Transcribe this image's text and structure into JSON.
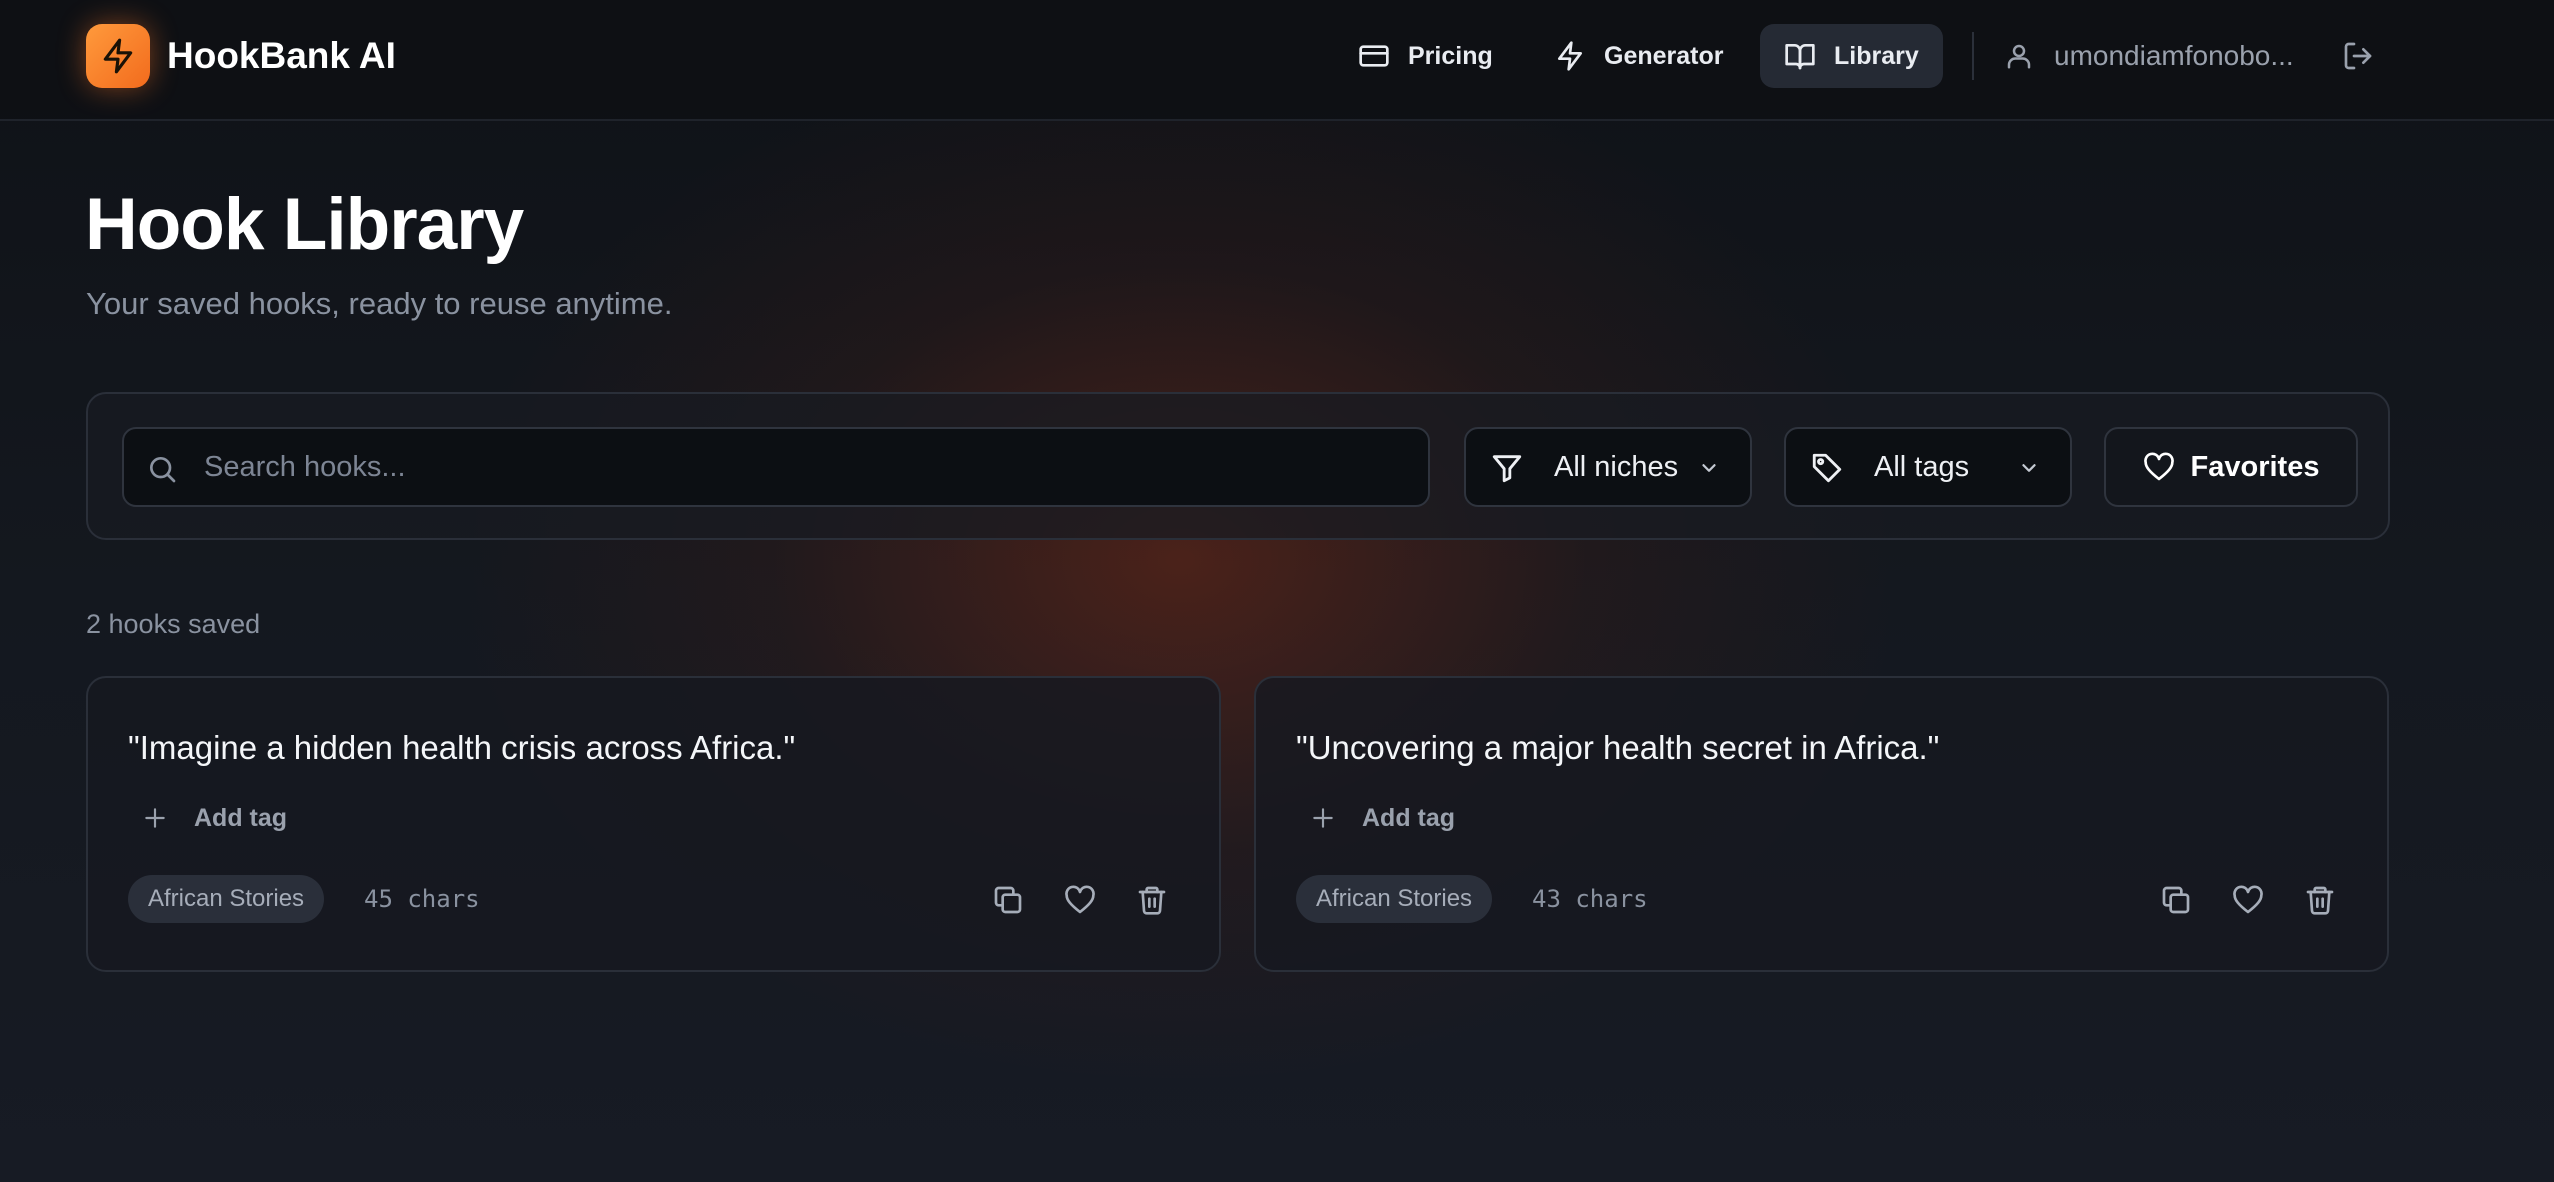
{
  "header": {
    "brand": "HookBank AI",
    "logo_icon": "lightning-icon",
    "nav": [
      {
        "label": "Pricing",
        "icon": "credit-card-icon",
        "active": false
      },
      {
        "label": "Generator",
        "icon": "lightning-icon",
        "active": false
      },
      {
        "label": "Library",
        "icon": "book-open-icon",
        "active": true
      }
    ],
    "user_label": "umondiamfonobo...",
    "user_icon": "user-icon",
    "logout_icon": "logout-icon"
  },
  "page": {
    "title": "Hook Library",
    "subtitle": "Your saved hooks, ready to reuse anytime."
  },
  "filters": {
    "search_placeholder": "Search hooks...",
    "search_value": "",
    "niche_dropdown": "All niches",
    "tag_dropdown": "All tags",
    "favorites_label": "Favorites"
  },
  "count_label": "2 hooks saved",
  "hooks": [
    {
      "text": "\"Imagine a hidden health crisis across Africa.\"",
      "add_tag_label": "Add tag",
      "niche": "African Stories",
      "chars": "45 chars"
    },
    {
      "text": "\"Uncovering a major health secret in Africa.\"",
      "add_tag_label": "Add tag",
      "niche": "African Stories",
      "chars": "43 chars"
    }
  ],
  "colors": {
    "accent": "#f47a24",
    "background": "#13161d",
    "surface": "#181b22",
    "border": "#2a2f39",
    "muted_text": "#8a92a0"
  }
}
